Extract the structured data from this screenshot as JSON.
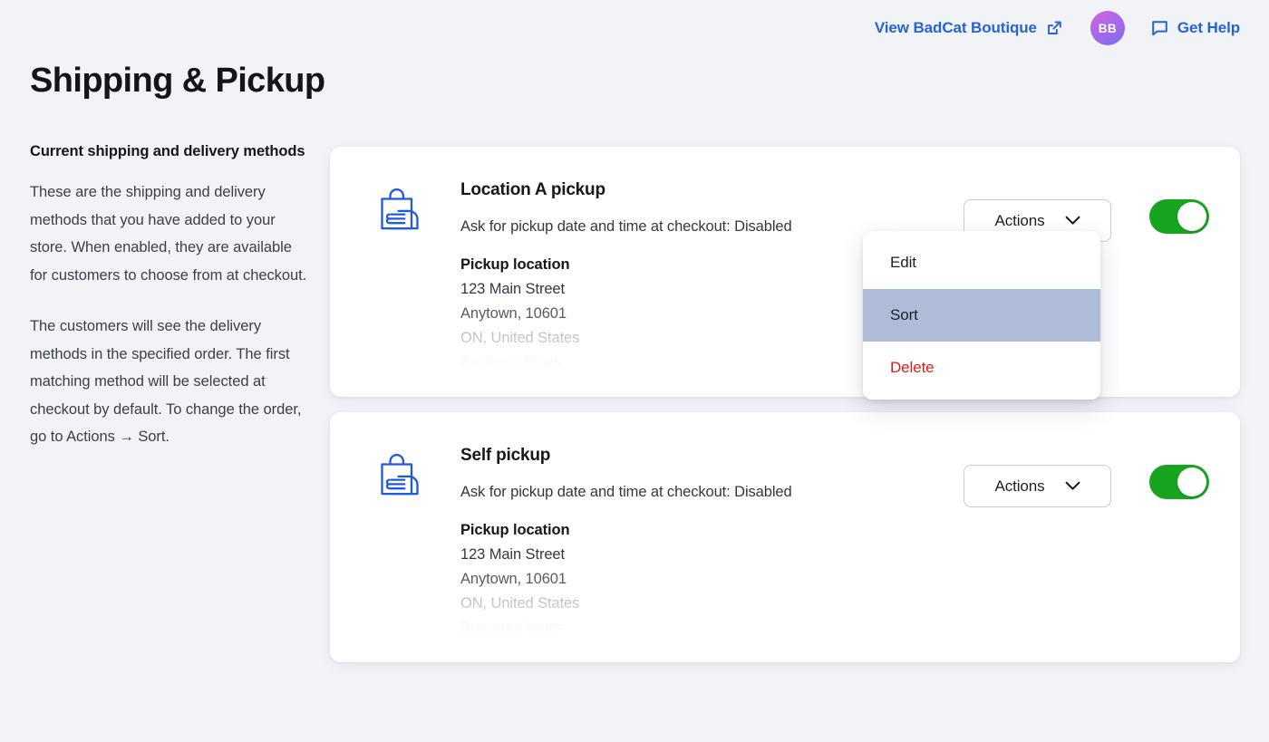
{
  "topbar": {
    "store_link_label": "View BadCat Boutique",
    "external_link_icon": "external-link-icon",
    "avatar_initials": "BB",
    "help_label": "Get Help",
    "chat_icon": "chat-bubble-icon"
  },
  "page": {
    "title": "Shipping & Pickup"
  },
  "side": {
    "heading": "Current shipping and delivery methods",
    "paragraph1": "These are the shipping and delivery methods that you have added to your store. When enabled, they are available for customers to choose from at checkout.",
    "paragraph2": "The customers will see the delivery methods in the specified order. The first matching method will be selected at checkout by default. To change the order, go to Actions → Sort."
  },
  "methods": [
    {
      "icon": "pickup-bag-hand-icon",
      "title": "Location A pickup",
      "subtitle": "Ask for pickup date and time at checkout: Disabled",
      "location_label": "Pickup location",
      "address_line1": "123 Main Street",
      "address_line2": "Anytown, 10601",
      "address_line3": "ON, United States",
      "address_line4": "Business hours",
      "actions_label": "Actions",
      "chevron_icon": "chevron-down-icon",
      "enabled": "on"
    },
    {
      "icon": "pickup-bag-hand-icon",
      "title": "Self pickup",
      "subtitle": "Ask for pickup date and time at checkout: Disabled",
      "location_label": "Pickup location",
      "address_line1": "123 Main Street",
      "address_line2": "Anytown, 10601",
      "address_line3": "ON, United States",
      "address_line4": "Business hours",
      "actions_label": "Actions",
      "chevron_icon": "chevron-down-icon",
      "enabled": "on"
    }
  ],
  "dropdown": {
    "items": [
      {
        "label": "Edit",
        "state": "normal"
      },
      {
        "label": "Sort",
        "state": "highlighted"
      },
      {
        "label": "Delete",
        "state": "danger"
      }
    ]
  },
  "colors": {
    "background": "#f2f3f7",
    "card": "#ffffff",
    "link_blue": "#2563d9",
    "icon_blue": "#2158e0",
    "toggle_green": "#17a41f",
    "menu_highlight": "#aebcd7",
    "danger_red": "#e01b1b",
    "title_text": "#13151a"
  }
}
